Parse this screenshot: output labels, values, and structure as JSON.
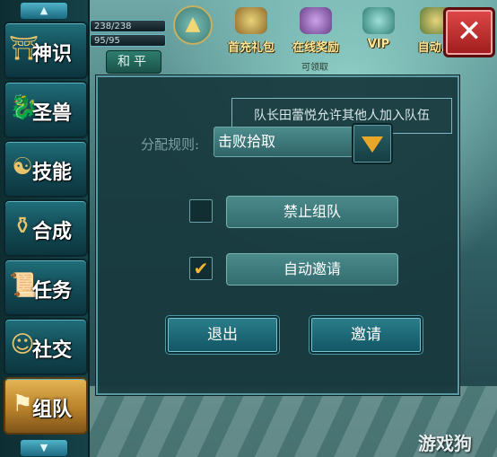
{
  "hud": {
    "hp": "238/238",
    "mp": "95/95",
    "pk_mode": "和平"
  },
  "top_icons": [
    {
      "label": "首充礼包"
    },
    {
      "label": "在线奖励"
    },
    {
      "label": "VIP"
    },
    {
      "label": "自动..."
    }
  ],
  "top_sub_label": "可领取",
  "close_symbol": "✕",
  "left_menu": {
    "up_arrow": "▲",
    "down_arrow": "▼",
    "items": [
      {
        "label": "神识",
        "icon": "pagoda-icon"
      },
      {
        "label": "圣兽",
        "icon": "dragon-icon"
      },
      {
        "label": "技能",
        "icon": "yin-yang-icon"
      },
      {
        "label": "合成",
        "icon": "furnace-icon"
      },
      {
        "label": "任务",
        "icon": "scroll-icon"
      },
      {
        "label": "社交",
        "icon": "portrait-icon"
      },
      {
        "label": "组队",
        "icon": "team-flag-icon",
        "active": true
      }
    ]
  },
  "team_panel": {
    "tooltip": "队长田蕾悦允许其他人加入队伍",
    "rule_label": "分配规则:",
    "rule_value": "击败拾取",
    "options": [
      {
        "label": "禁止组队",
        "checked": false
      },
      {
        "label": "自动邀请",
        "checked": true
      }
    ],
    "quit_label": "退出",
    "invite_label": "邀请"
  },
  "watermark": "游戏狗",
  "colors": {
    "accent_gold": "#e9a72a",
    "close_red": "#c83232",
    "panel_bg": "#183a3e"
  }
}
